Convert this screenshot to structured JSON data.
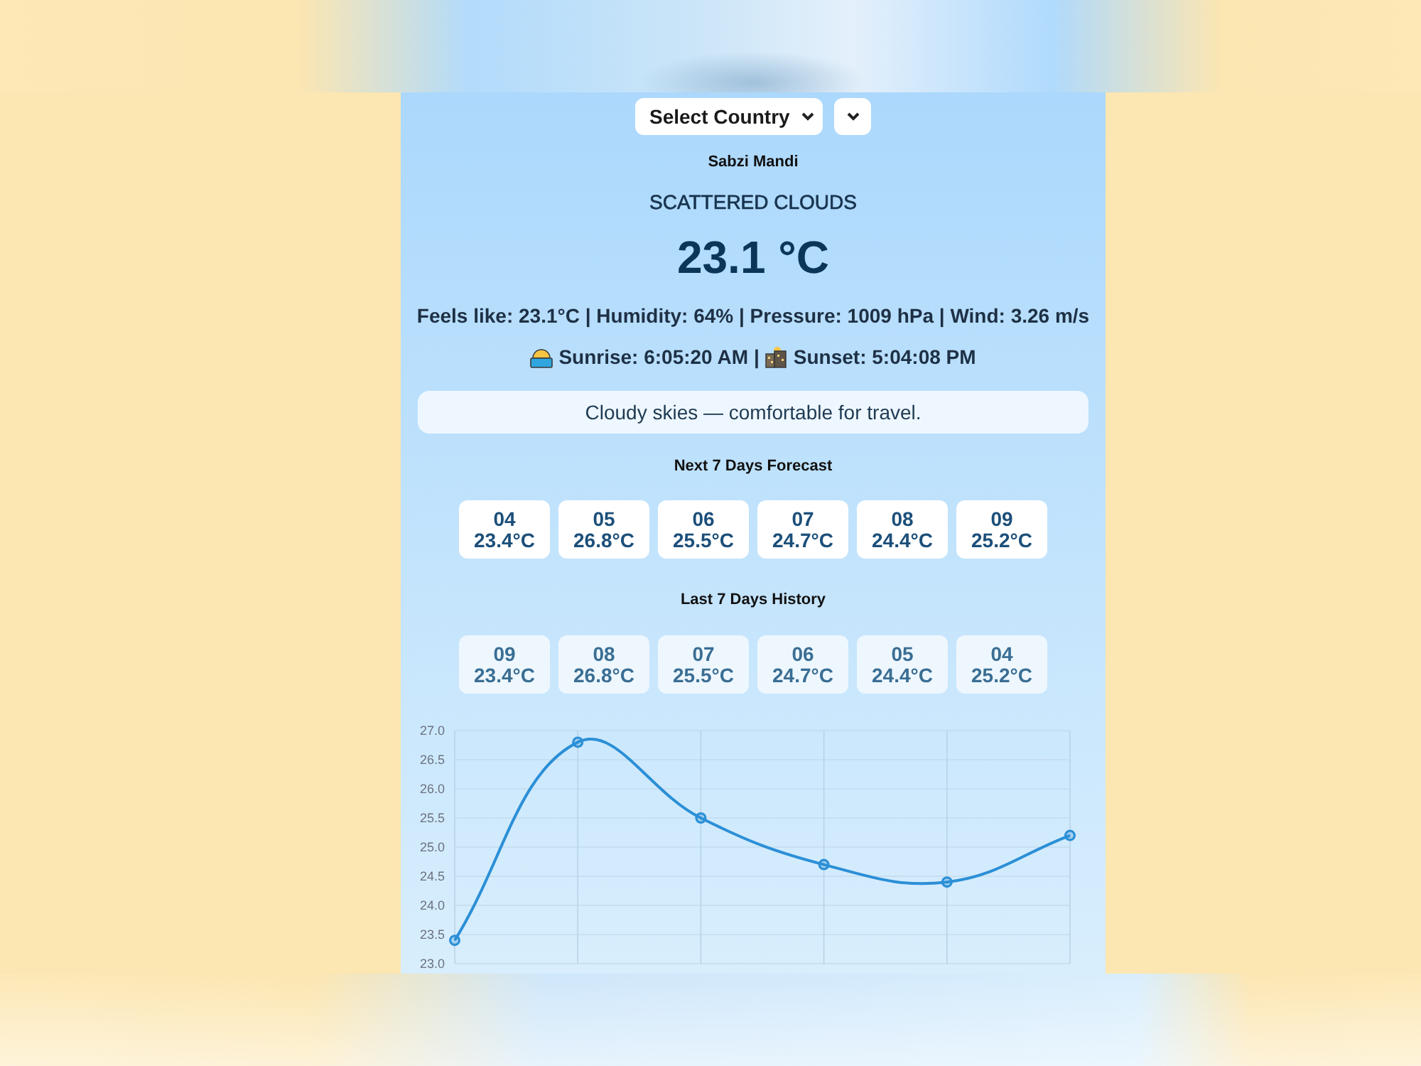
{
  "country_select": {
    "value": "Select Country"
  },
  "location": "Sabzi Mandi",
  "condition": "SCATTERED CLOUDS",
  "temperature": "23.1 °C",
  "details": "Feels like: 23.1°C | Humidity: 64% | Pressure: 1009 hPa | Wind: 3.26 m/s",
  "sun": {
    "sunrise": "Sunrise: 6:05:20 AM",
    "separator": "|",
    "sunset": "Sunset: 5:04:08 PM"
  },
  "advice": "Cloudy skies — comfortable for travel.",
  "sections": [
    {
      "kind": "forecast",
      "title": "Next 7 Days Forecast",
      "days": [
        {
          "day": "04",
          "temp": "23.4°C"
        },
        {
          "day": "05",
          "temp": "26.8°C"
        },
        {
          "day": "06",
          "temp": "25.5°C"
        },
        {
          "day": "07",
          "temp": "24.7°C"
        },
        {
          "day": "08",
          "temp": "24.4°C"
        },
        {
          "day": "09",
          "temp": "25.2°C"
        }
      ]
    },
    {
      "kind": "history",
      "title": "Last 7 Days History",
      "days": [
        {
          "day": "09",
          "temp": "23.4°C"
        },
        {
          "day": "08",
          "temp": "26.8°C"
        },
        {
          "day": "07",
          "temp": "25.5°C"
        },
        {
          "day": "06",
          "temp": "24.7°C"
        },
        {
          "day": "05",
          "temp": "24.4°C"
        },
        {
          "day": "04",
          "temp": "25.2°C"
        }
      ]
    }
  ],
  "chart": {
    "chart_data": {
      "type": "line",
      "grid": true,
      "series": [
        {
          "color": "#2b8fd6",
          "marker": "circle",
          "values": [
            23.4,
            26.8,
            25.5,
            24.7,
            24.4,
            25.2
          ]
        }
      ],
      "ylim": [
        23,
        27
      ],
      "yticks": [
        {
          "value": 23,
          "label": "23.0"
        },
        23.5,
        {
          "value": 24,
          "label": "24.0"
        },
        24.5,
        {
          "value": 25,
          "label": "25.0"
        },
        25.5,
        {
          "value": 26,
          "label": "26.0"
        },
        26.5,
        {
          "value": 27,
          "label": "27.0"
        }
      ]
    }
  }
}
